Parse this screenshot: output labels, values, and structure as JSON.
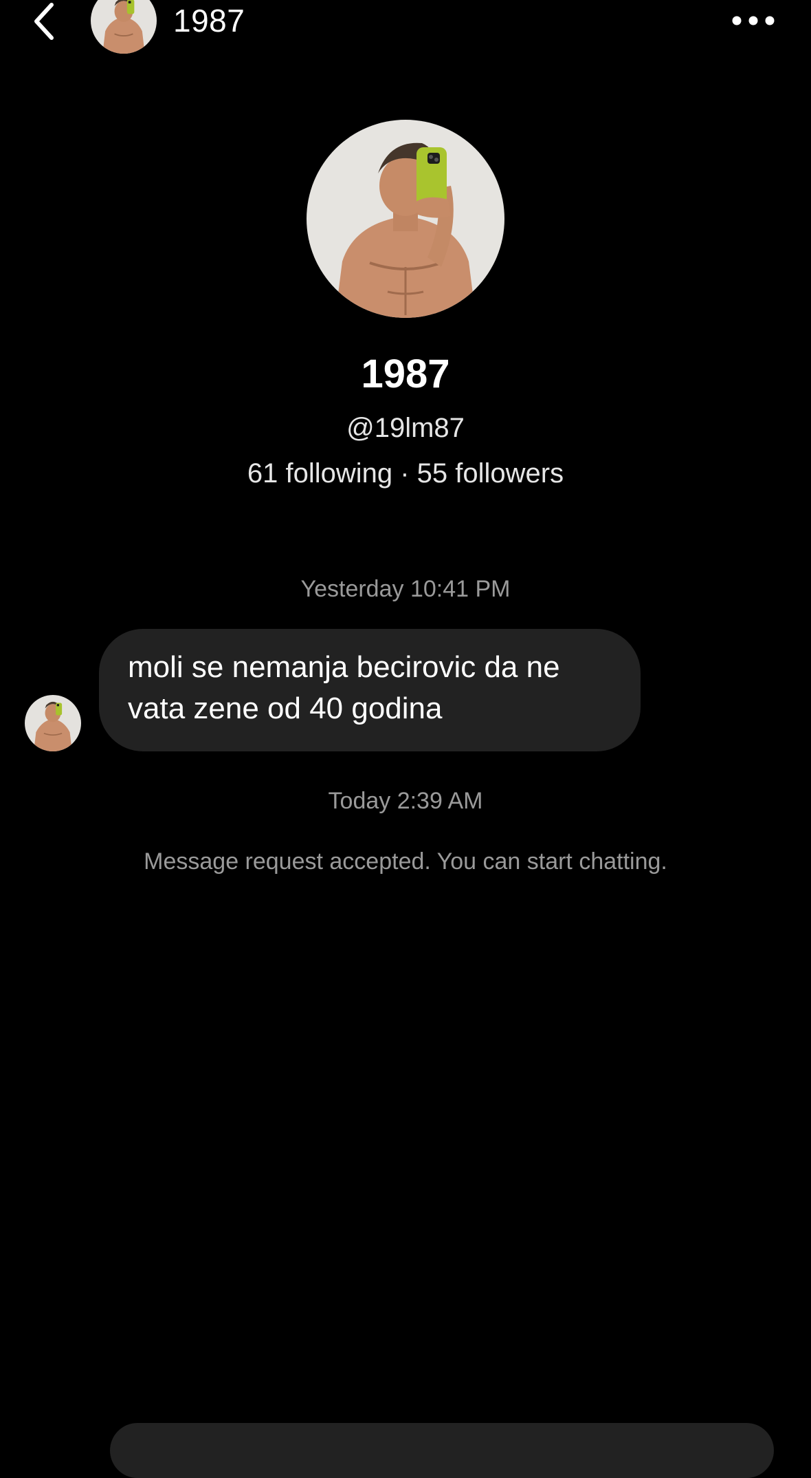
{
  "header": {
    "title": "1987",
    "back_icon": "chevron-left-icon",
    "more_icon": "more-horizontal-icon"
  },
  "profile": {
    "name": "1987",
    "handle": "@19lm87",
    "stats": "61 following · 55 followers"
  },
  "conversation": {
    "timestamps": [
      "Yesterday 10:41 PM",
      "Today 2:39 AM"
    ],
    "messages": [
      {
        "sender": "other",
        "text": "moli se nemanja becirovic da ne vata zene od 40 godina"
      }
    ],
    "system_message": "Message request accepted. You can start chatting."
  },
  "colors": {
    "background": "#000000",
    "bubble": "#222222",
    "muted_text": "#9a9a9a",
    "text": "#ffffff"
  }
}
